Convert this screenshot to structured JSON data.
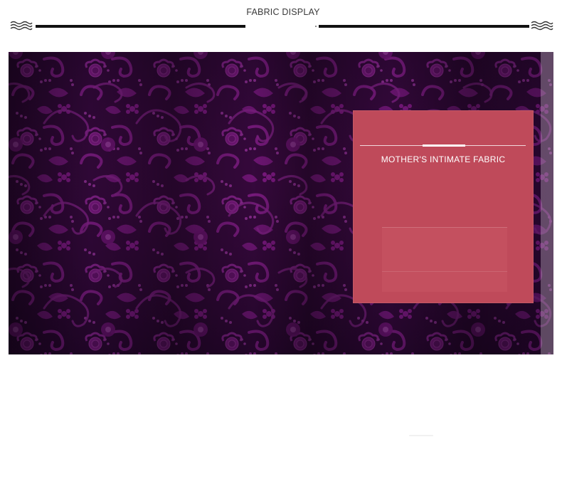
{
  "header": {
    "title": "FABRIC DISPLAY",
    "left_ornament": "wave-icon",
    "right_ornament": "wave-icon"
  },
  "fabric_image": {
    "description_icon": "purple-burnout-velvet-floral-fabric",
    "colors": {
      "base": "#2a0830",
      "pattern": "#8a1d8e",
      "highlight": "#a83aa9"
    }
  },
  "label_card": {
    "title": "MOTHER'S INTIMATE FABRIC",
    "background": "#bf4a5a"
  }
}
